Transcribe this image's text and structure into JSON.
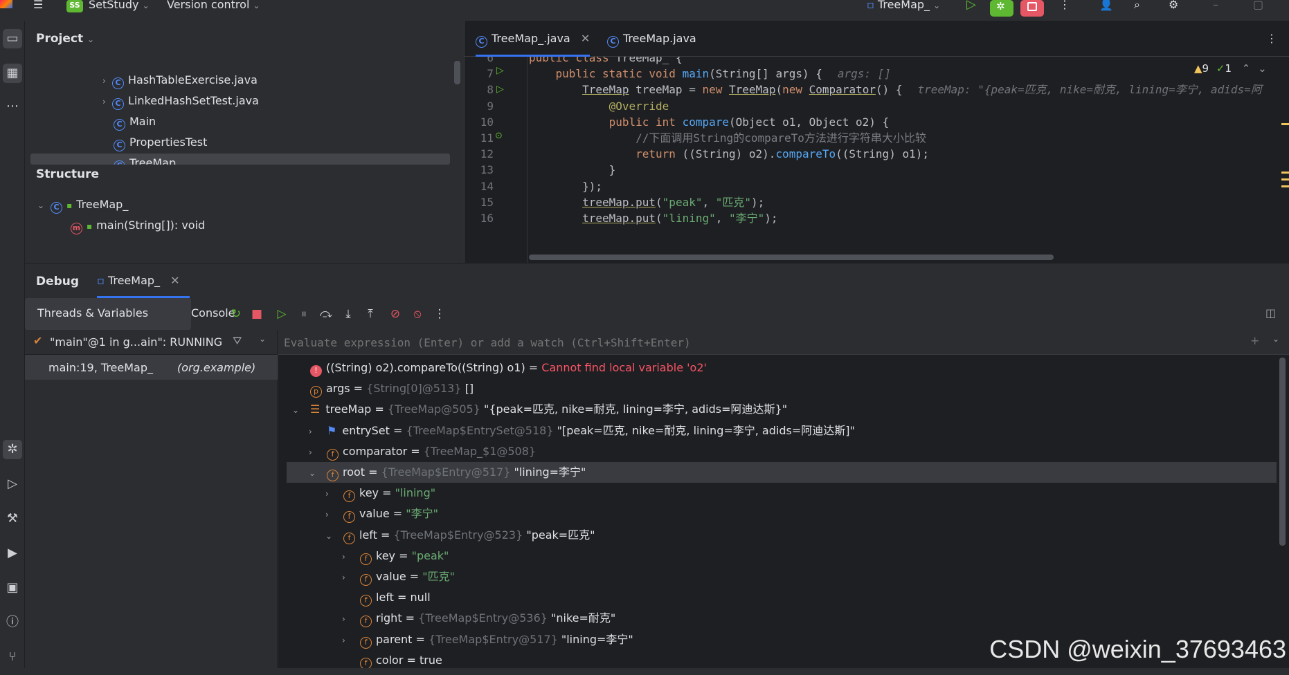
{
  "titlebar": {
    "project_badge": "SS",
    "project_name": "SetStudy",
    "vcs": "Version control",
    "run_config": "TreeMap_"
  },
  "project_panel": {
    "title": "Project",
    "items": [
      {
        "label": "HashTableExercise.java",
        "expandable": true
      },
      {
        "label": "LinkedHashSetTest.java",
        "expandable": true
      },
      {
        "label": "Main",
        "expandable": false
      },
      {
        "label": "PropertiesTest",
        "expandable": false
      },
      {
        "label": "TreeMap_",
        "expandable": false
      }
    ]
  },
  "structure_panel": {
    "title": "Structure",
    "root": "TreeMap_",
    "child": "main(String[]): void"
  },
  "editor": {
    "tabs": [
      {
        "label": "TreeMap_.java",
        "active": true
      },
      {
        "label": "TreeMap.java",
        "active": false
      }
    ],
    "inspections": {
      "warnings": "9",
      "ok": "1"
    },
    "lines": [
      {
        "n": "6",
        "text": "public class TreeMap_ {"
      },
      {
        "n": "7",
        "text": "    public static void main(String[] args) {",
        "hint": "args: []"
      },
      {
        "n": "8",
        "text": "        TreeMap treeMap = new TreeMap(new Comparator() {",
        "hint": "treeMap: \"{peak=匹克, nike=耐克, lining=李宁, adids=阿"
      },
      {
        "n": "9",
        "text": "            @Override"
      },
      {
        "n": "10",
        "text": "            public int compare(Object o1, Object o2) {"
      },
      {
        "n": "11",
        "text": "                //下面调用String的compareTo方法进行字符串大小比较"
      },
      {
        "n": "12",
        "text": "                return ((String) o2).compareTo((String) o1);"
      },
      {
        "n": "13",
        "text": "            }"
      },
      {
        "n": "14",
        "text": "        });"
      },
      {
        "n": "15",
        "text": "        treeMap.put(\"peak\", \"匹克\");"
      },
      {
        "n": "16",
        "text": "        treeMap.put(\"lining\", \"李宁\");"
      }
    ]
  },
  "debug": {
    "title": "Debug",
    "session_tab": "TreeMap_",
    "subtabs": [
      "Threads & Variables",
      "Console"
    ],
    "thread_status": "\"main\"@1 in g...ain\": RUNNING",
    "frame": "main:19, TreeMap_",
    "frame_pkg": "(org.example)",
    "eval_placeholder": "Evaluate expression (Enter) or add a watch (Ctrl+Shift+Enter)",
    "variables": [
      {
        "indent": 0,
        "arrow": "",
        "icon": "error",
        "name": "((String) o2).compareTo((String) o1)",
        "eq": " = ",
        "ref": "",
        "value": "Cannot find local variable 'o2'",
        "vtype": "err"
      },
      {
        "indent": 0,
        "arrow": "",
        "icon": "p",
        "name": "args",
        "eq": " = ",
        "ref": "{String[0]@513}",
        "value": " []",
        "vtype": "plain"
      },
      {
        "indent": 0,
        "arrow": "v",
        "icon": "list",
        "name": "treeMap",
        "eq": " = ",
        "ref": "{TreeMap@505}",
        "value": " \"{peak=匹克, nike=耐克, lining=李宁, adids=阿迪达斯}\"",
        "vtype": "plain"
      },
      {
        "indent": 1,
        "arrow": ">",
        "icon": "flag",
        "name": "entrySet",
        "eq": " = ",
        "ref": "{TreeMap$EntrySet@518}",
        "value": " \"[peak=匹克, nike=耐克, lining=李宁, adids=阿迪达斯]\"",
        "vtype": "plain"
      },
      {
        "indent": 1,
        "arrow": ">",
        "icon": "f",
        "name": "comparator",
        "eq": " = ",
        "ref": "{TreeMap_$1@508}",
        "value": "",
        "vtype": "plain"
      },
      {
        "indent": 1,
        "arrow": "v",
        "icon": "f",
        "name": "root",
        "eq": " = ",
        "ref": "{TreeMap$Entry@517}",
        "value": " \"lining=李宁\"",
        "vtype": "plain",
        "selected": true
      },
      {
        "indent": 2,
        "arrow": ">",
        "icon": "f",
        "name": "key",
        "eq": " = ",
        "ref": "",
        "value": "\"lining\"",
        "vtype": "str"
      },
      {
        "indent": 2,
        "arrow": ">",
        "icon": "f",
        "name": "value",
        "eq": " = ",
        "ref": "",
        "value": "\"李宁\"",
        "vtype": "str"
      },
      {
        "indent": 2,
        "arrow": "v",
        "icon": "f",
        "name": "left",
        "eq": " = ",
        "ref": "{TreeMap$Entry@523}",
        "value": " \"peak=匹克\"",
        "vtype": "plain"
      },
      {
        "indent": 3,
        "arrow": ">",
        "icon": "f",
        "name": "key",
        "eq": " = ",
        "ref": "",
        "value": "\"peak\"",
        "vtype": "str"
      },
      {
        "indent": 3,
        "arrow": ">",
        "icon": "f",
        "name": "value",
        "eq": " = ",
        "ref": "",
        "value": "\"匹克\"",
        "vtype": "str"
      },
      {
        "indent": 3,
        "arrow": "",
        "icon": "f",
        "name": "left",
        "eq": " = ",
        "ref": "",
        "value": "null",
        "vtype": "plain"
      },
      {
        "indent": 3,
        "arrow": ">",
        "icon": "f",
        "name": "right",
        "eq": " = ",
        "ref": "{TreeMap$Entry@536}",
        "value": " \"nike=耐克\"",
        "vtype": "plain"
      },
      {
        "indent": 3,
        "arrow": ">",
        "icon": "f",
        "name": "parent",
        "eq": " = ",
        "ref": "{TreeMap$Entry@517}",
        "value": " \"lining=李宁\"",
        "vtype": "plain"
      },
      {
        "indent": 3,
        "arrow": "",
        "icon": "f",
        "name": "color",
        "eq": " = ",
        "ref": "",
        "value": "true",
        "vtype": "plain"
      }
    ]
  },
  "watermark": "CSDN @weixin_37693463",
  "colors": {
    "accent": "#3574f0",
    "run": "#5fb832",
    "stop": "#e55765"
  }
}
